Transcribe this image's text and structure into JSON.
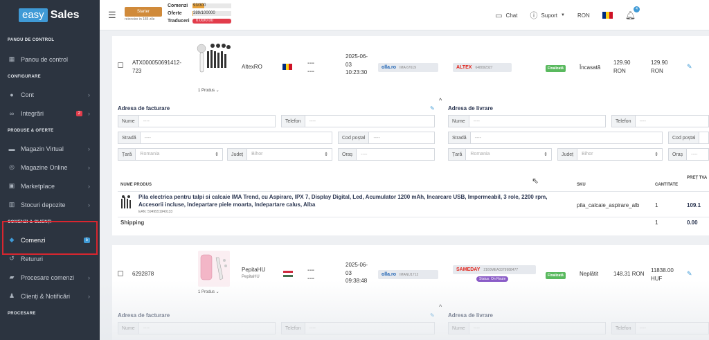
{
  "brand": {
    "easy": "easy",
    "sales": "Sales"
  },
  "sidebar": {
    "sections": {
      "panou": "PANOU DE CONTROL",
      "configurare": "CONFIGURARE",
      "produse": "PRODUSE & OFERTE",
      "comenzi": "COMENZI & CLIENȚI",
      "procesare": "PROCESARE"
    },
    "items": {
      "panou": "Panou de control",
      "cont": "Cont",
      "integrari": "Integrări",
      "integrari_badge": "2",
      "magazin_virtual": "Magazin Virtual",
      "magazine_online": "Magazine Online",
      "marketplace": "Marketplace",
      "stocuri": "Stocuri depozite",
      "comenzi": "Comenzi",
      "comenzi_badge": "5",
      "retururi": "Retururi",
      "procesare_comenzi": "Procesare comenzi",
      "clienti": "Clienți & Notificări"
    }
  },
  "topbar": {
    "plan_label": "Starter",
    "plan_note": "reinnoire in 185 zile",
    "quotas": {
      "comenzi_label": "Comenzi",
      "comenzi_value": "93/300",
      "comenzi_fill": 0.31,
      "oferte_label": "Oferte",
      "oferte_value": "389/100000",
      "oferte_fill": 0.004,
      "traduceri_label": "Traduceri",
      "traduceri_value": "0.00/0.00",
      "traduceri_fill": 1.0
    },
    "chat": "Chat",
    "suport": "Suport",
    "currency": "RON",
    "notifications": "4",
    "colors": {
      "orange": "#d08a3a",
      "red": "#e23c4b",
      "blue": "#3f9ad6"
    }
  },
  "order1": {
    "id": "ATX000050691412-723",
    "produse": "1 Produs",
    "store": "AltexRO",
    "dash1": "---",
    "dash2": "---",
    "date": "2025-06-03 10:23:30",
    "courier_logo": "olla.ro",
    "courier_code": "IMA 67619",
    "marketplace_logo": "ALTEX",
    "marketplace_code": "648092327",
    "status": "Finalizată",
    "payment": "Încasată",
    "amount1": "129.90 RON",
    "amount2": "129.90 RON",
    "billing": {
      "title": "Adresa de facturare",
      "nume": "Nume",
      "telefon": "Telefon",
      "strada": "Stradă",
      "cod_postal": "Cod poștal",
      "tara": "Țară",
      "tara_val": "Romania",
      "judet": "Județ",
      "judet_val": "Bihor",
      "oras": "Oraș",
      "placeholder": "----"
    },
    "shipping": {
      "title": "Adresa de livrare",
      "nume": "Nume",
      "telefon": "Telefon",
      "strada": "Stradă",
      "cod_postal": "Cod poștal",
      "tara": "Țară",
      "tara_val": "Romania",
      "judet": "Județ",
      "judet_val": "Bihor",
      "oras": "Oraș",
      "placeholder": "----"
    },
    "table": {
      "col_name": "NUME PRODUS",
      "col_sku": "SKU",
      "col_qty": "CANTITATE",
      "col_price": "PREȚ TVA",
      "product_name": "Pila electrica pentru talpi si calcaie IMA Trend, cu Aspirare, IPX 7, Display Digital, Led, Acumulator 1200 mAh, Incarcare USB, Impermeabil, 3 role, 2200 rpm, Accesorii incluse, Indepartare piele moarta, Indepartare calus, Alba",
      "ean": "EAN: 5949551940133",
      "sku": "pila_calcaie_aspirare_alb",
      "qty": "1",
      "price": "109.1",
      "shipping_label": "Shipping",
      "shipping_qty": "1",
      "shipping_price": "0.00"
    }
  },
  "order2": {
    "id": "6292878",
    "produse": "1 Produs",
    "store": "PepitaHU",
    "store_sub": "PepitaHU",
    "dash1": "---",
    "dash2": "---",
    "date": "2025-06-03 09:38:48",
    "courier_logo": "olla.ro",
    "courier_code": "IMANU1712",
    "marketplace_logo": "SAMEDAY",
    "marketplace_code": "2160MEA0379988477",
    "shipping_status": "Status: On Route",
    "status": "Finalizată",
    "payment": "Neplătit",
    "amount1": "148.31 RON",
    "amount2": "11838.00 HUF",
    "billing_title": "Adresa de facturare",
    "shipping_title": "Adresa de livrare",
    "nume": "Nume",
    "telefon": "Telefon",
    "placeholder": "----"
  }
}
